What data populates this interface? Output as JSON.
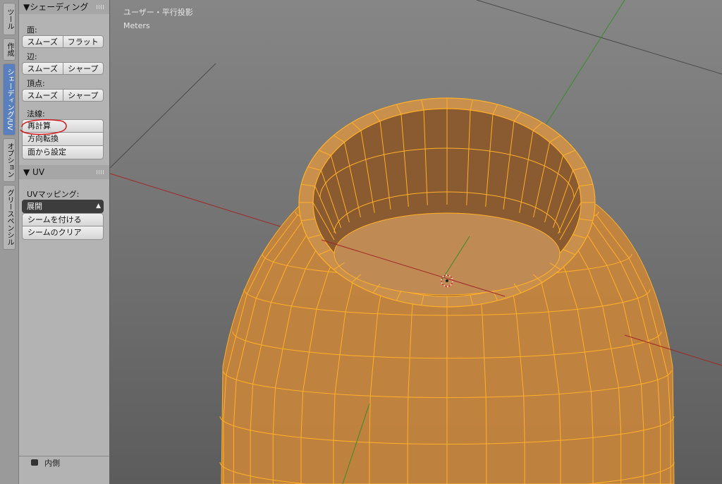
{
  "tabs": [
    {
      "label": "ツール",
      "active": false
    },
    {
      "label": "作成",
      "active": false
    },
    {
      "label": "シェーディング/UV",
      "active": true
    },
    {
      "label": "オプション",
      "active": false
    },
    {
      "label": "グリースペンシル",
      "active": false
    }
  ],
  "shading": {
    "header": "▼シェーディング",
    "face_label": "面:",
    "face_smooth": "スムーズ",
    "face_flat": "フラット",
    "edge_label": "辺:",
    "edge_smooth": "スムーズ",
    "edge_sharp": "シャープ",
    "vertex_label": "頂点:",
    "vertex_smooth": "スムーズ",
    "vertex_sharp": "シャープ",
    "normals_label": "法線:",
    "recalculate": "再計算",
    "flip_direction": "方向転換",
    "set_from_faces": "面から設定"
  },
  "uv": {
    "header": "▼ UV",
    "mapping_label": "UVマッピング:",
    "unwrap": "展開",
    "mark_seam": "シームを付ける",
    "clear_seam": "シームのクリア"
  },
  "bottom": {
    "inner_label": "内側"
  },
  "viewport": {
    "view_name": "ユーザー・平行投影",
    "units": "Meters"
  },
  "colors": {
    "mesh_fill": "#c8863c",
    "mesh_wire": "#ffb028",
    "active_tab": "#5a7fbf",
    "annotation": "#d01818",
    "x_axis": "#a02828",
    "y_axis": "#3a8a2a"
  }
}
